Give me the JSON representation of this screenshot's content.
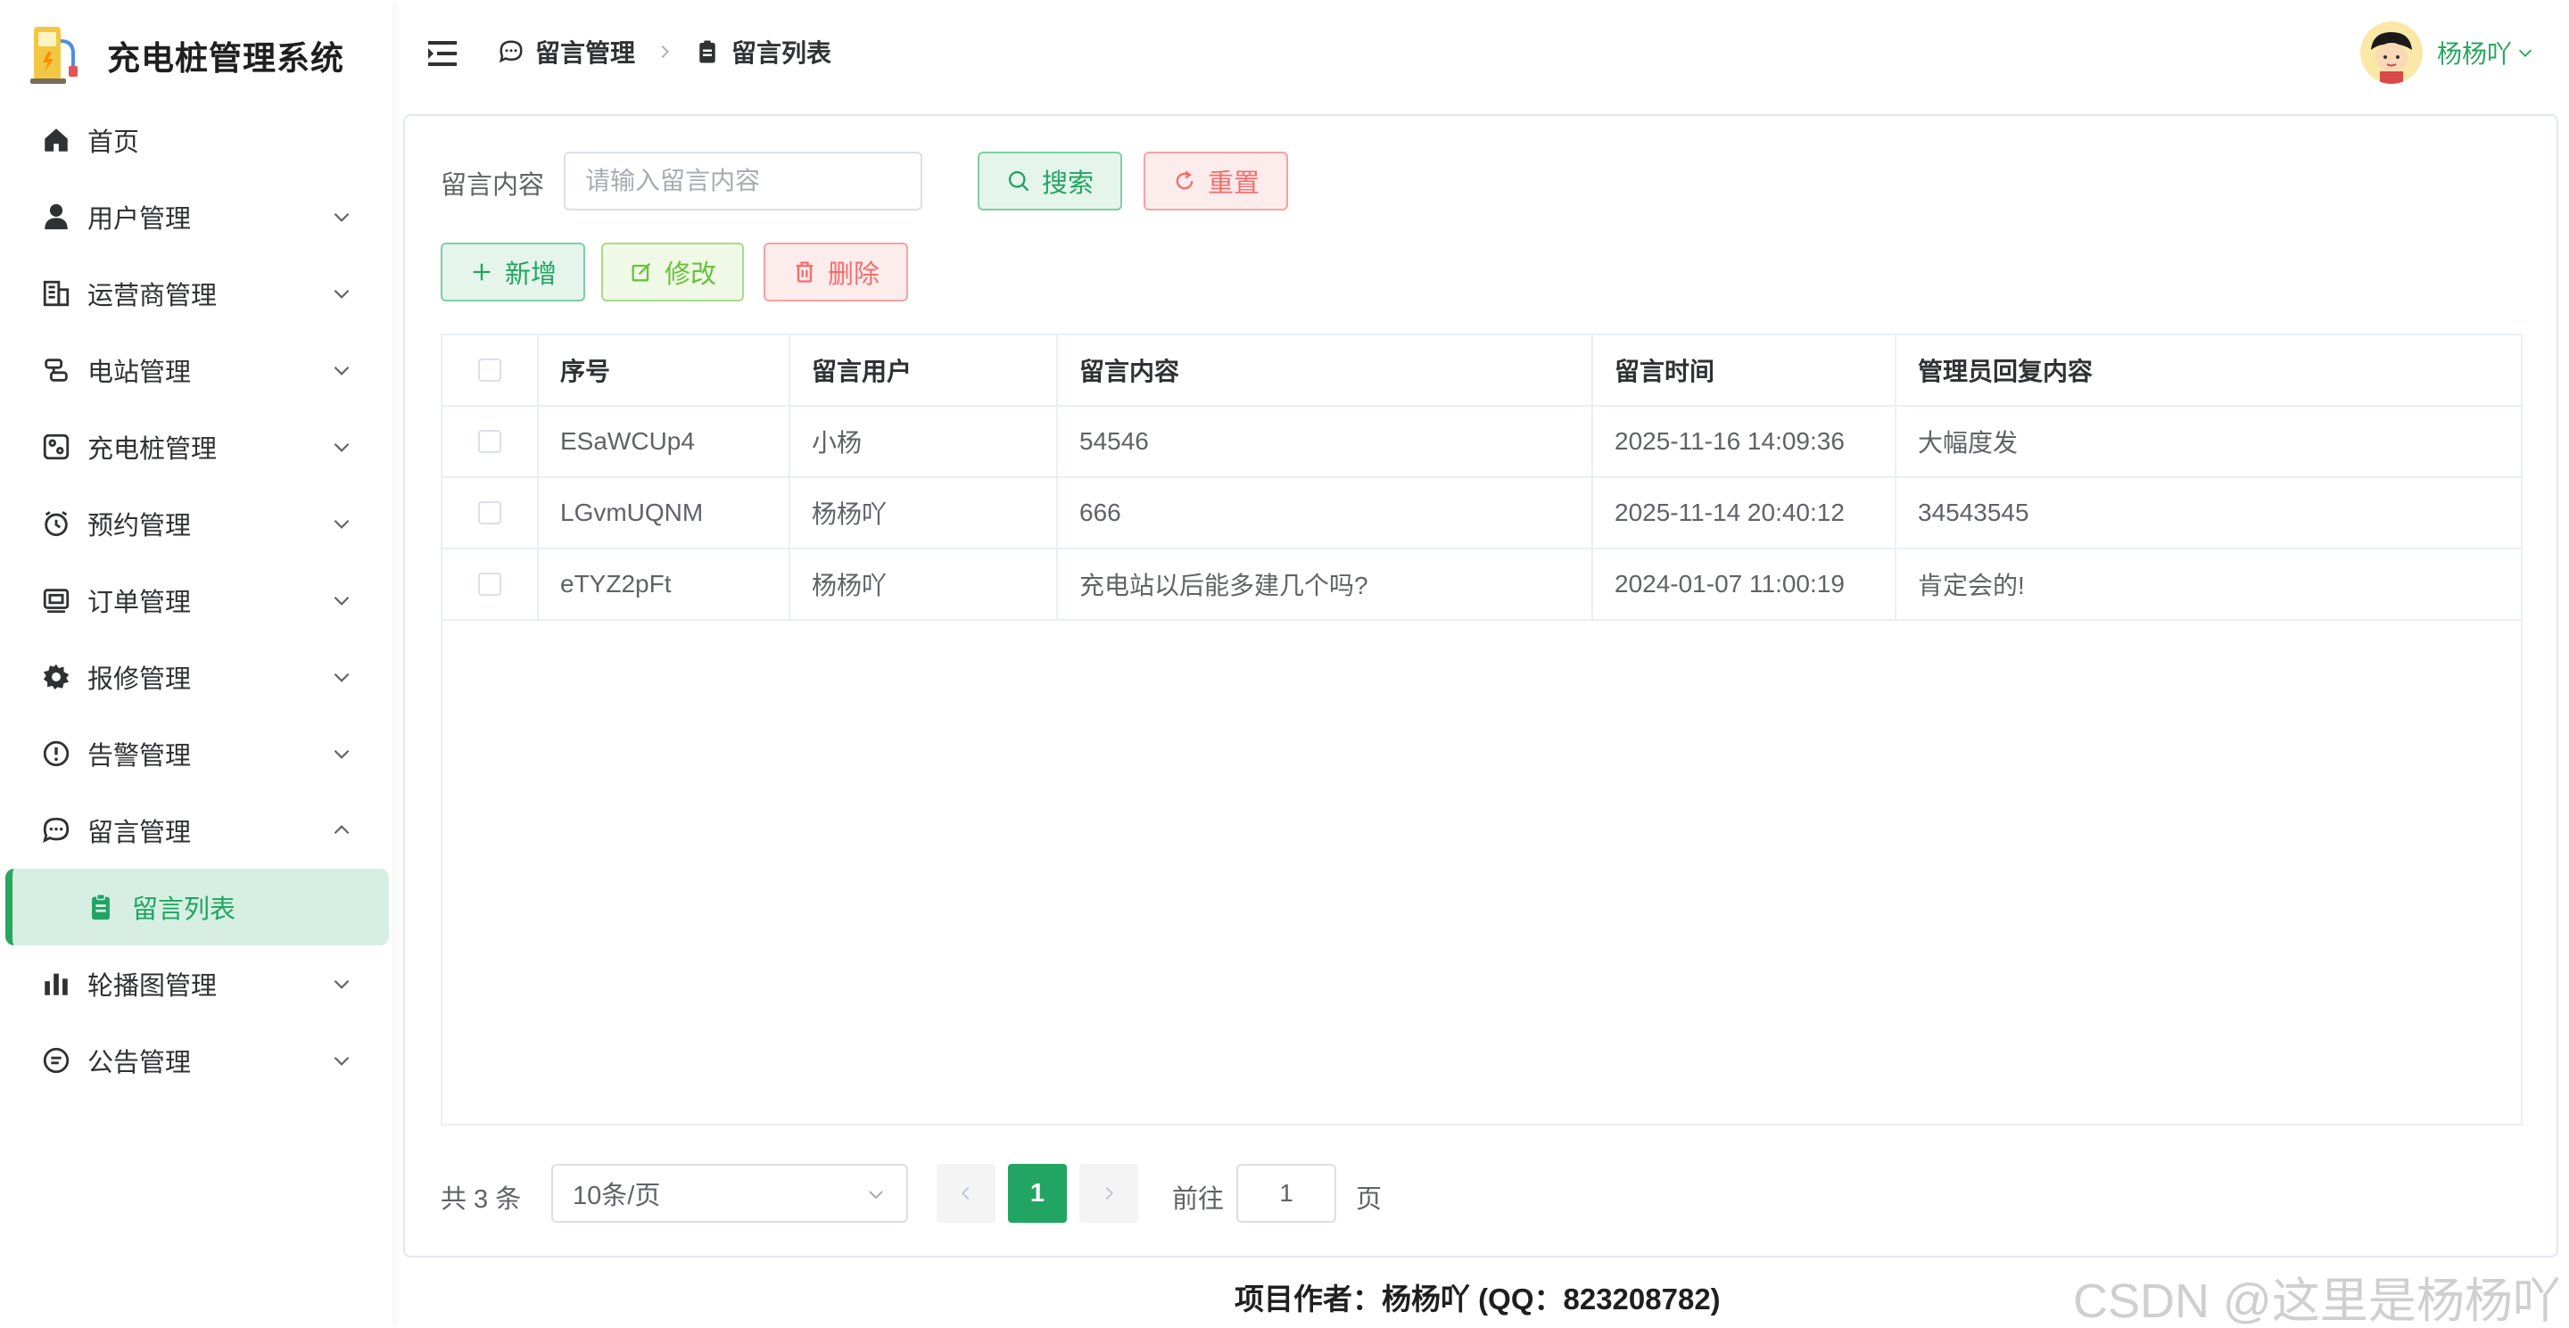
{
  "app": {
    "title": "充电桩管理系统"
  },
  "sidebar": {
    "items": [
      {
        "label": "首页",
        "icon": "home-icon"
      },
      {
        "label": "用户管理",
        "icon": "user-icon"
      },
      {
        "label": "运营商管理",
        "icon": "building-icon"
      },
      {
        "label": "电站管理",
        "icon": "station-icon"
      },
      {
        "label": "充电桩管理",
        "icon": "charger-icon"
      },
      {
        "label": "预约管理",
        "icon": "alarm-clock-icon"
      },
      {
        "label": "订单管理",
        "icon": "order-icon"
      },
      {
        "label": "报修管理",
        "icon": "gear-icon"
      },
      {
        "label": "告警管理",
        "icon": "warning-icon"
      },
      {
        "label": "留言管理",
        "icon": "chat-icon"
      },
      {
        "label": "留言列表",
        "icon": "clipboard-icon"
      },
      {
        "label": "轮播图管理",
        "icon": "bar-chart-icon"
      },
      {
        "label": "公告管理",
        "icon": "announcement-icon"
      }
    ]
  },
  "breadcrumb": {
    "parent": "留言管理",
    "current": "留言列表"
  },
  "user": {
    "name": "杨杨吖"
  },
  "search": {
    "label": "留言内容",
    "placeholder": "请输入留言内容",
    "value": ""
  },
  "buttons": {
    "search": "搜索",
    "reset": "重置",
    "add": "新增",
    "edit": "修改",
    "delete": "删除"
  },
  "table": {
    "headers": [
      "序号",
      "留言用户",
      "留言内容",
      "留言时间",
      "管理员回复内容"
    ],
    "rows": [
      [
        "ESaWCUp4",
        "小杨",
        "54546",
        "2025-11-16 14:09:36",
        "大幅度发"
      ],
      [
        "LGvmUQNM",
        "杨杨吖",
        "666",
        "2025-11-14 20:40:12",
        "34543545"
      ],
      [
        "eTYZ2pFt",
        "杨杨吖",
        "充电站以后能多建几个吗?",
        "2024-01-07 11:00:19",
        "肯定会的!"
      ]
    ]
  },
  "pagination": {
    "total": "共 3 条",
    "page_size": "10条/页",
    "current": "1",
    "goto_label": "前往",
    "goto_value": "1",
    "page_label": "页"
  },
  "footer": {
    "text": "项目作者：杨杨吖 (QQ：823208782)"
  },
  "watermark": {
    "text": "CSDN @这里是杨杨吖"
  },
  "colors": {
    "accent": "#22a463",
    "danger": "#f56c6c",
    "edit": "#67c23a",
    "active_bg": "#d6efe2"
  }
}
